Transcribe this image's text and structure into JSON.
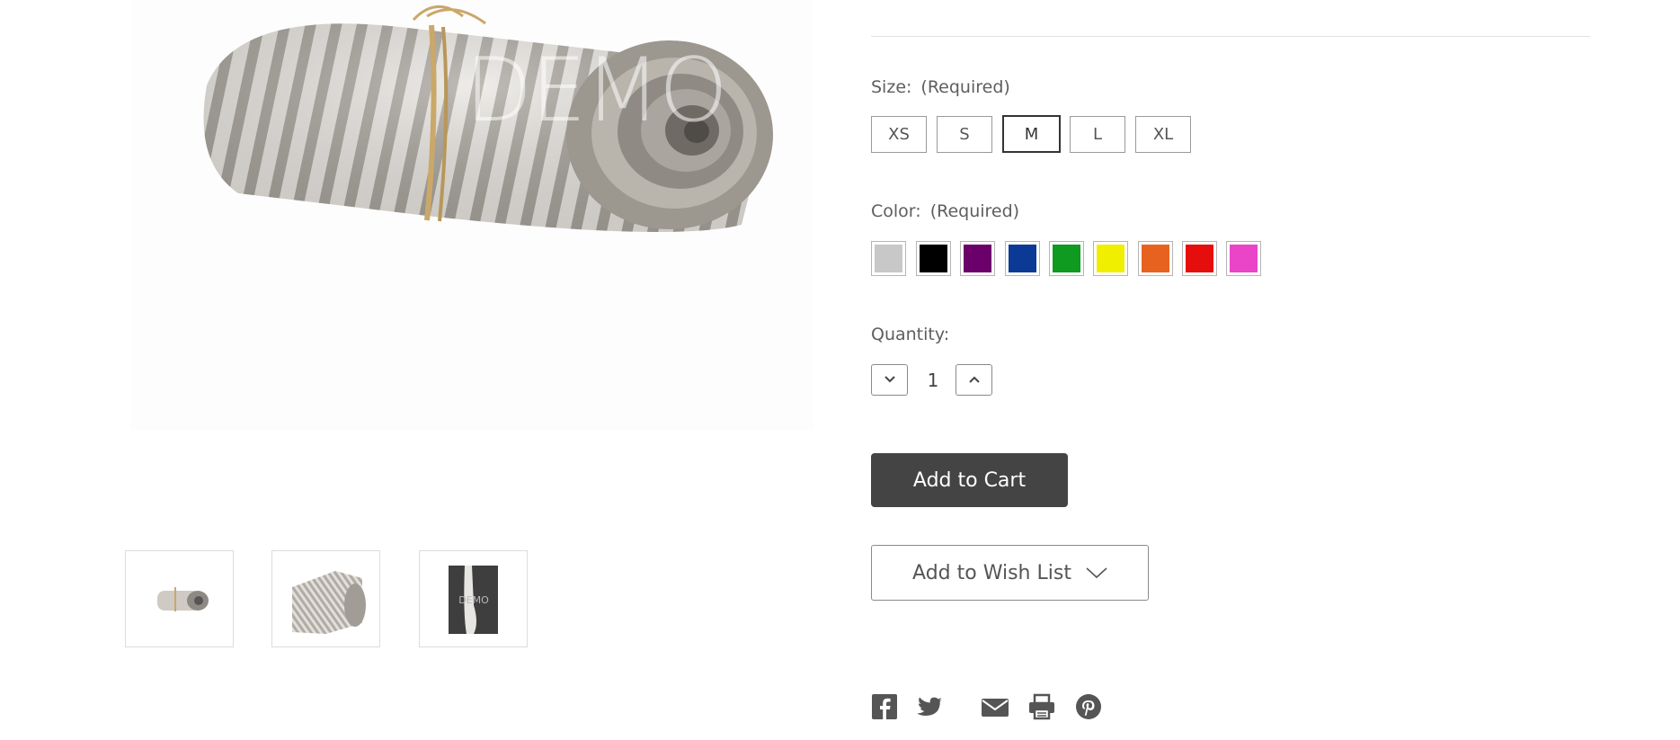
{
  "product_image": {
    "watermark": "DEMO",
    "thumbnails": [
      {
        "name": "rolled-towel"
      },
      {
        "name": "rolled-towel-angle"
      },
      {
        "name": "hanging-towel",
        "watermark": "DEMO"
      }
    ]
  },
  "options": {
    "size": {
      "label": "Size:",
      "required": "(Required)",
      "values": [
        "XS",
        "S",
        "M",
        "L",
        "XL"
      ],
      "selected": "M"
    },
    "color": {
      "label": "Color:",
      "required": "(Required)",
      "swatches": [
        {
          "name": "silver",
          "hex": "#c8c8c8"
        },
        {
          "name": "black",
          "hex": "#000000"
        },
        {
          "name": "purple",
          "hex": "#6b006b"
        },
        {
          "name": "blue",
          "hex": "#0b3a96"
        },
        {
          "name": "green",
          "hex": "#0f9a20"
        },
        {
          "name": "yellow",
          "hex": "#f1ef00"
        },
        {
          "name": "orange",
          "hex": "#e8621f"
        },
        {
          "name": "red",
          "hex": "#e60d0d"
        },
        {
          "name": "pink",
          "hex": "#ea45c8"
        }
      ]
    },
    "quantity": {
      "label": "Quantity:",
      "value": "1"
    }
  },
  "actions": {
    "add_to_cart": "Add to Cart",
    "add_to_wishlist": "Add to Wish List"
  },
  "share_icons": [
    "facebook-icon",
    "twitter-icon",
    "email-icon",
    "print-icon",
    "pinterest-icon"
  ],
  "colors": {
    "button_dark": "#444444",
    "text": "#5e5e5e"
  }
}
